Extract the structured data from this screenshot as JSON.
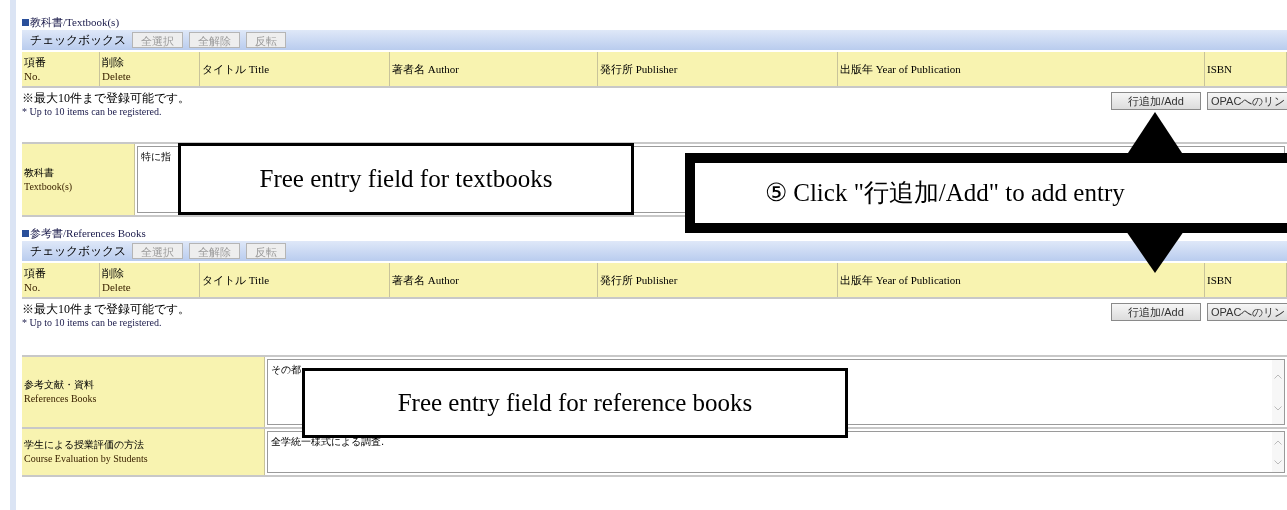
{
  "sections": [
    {
      "title": "教科書/Textbook(s)",
      "toolbar": {
        "label": "チェックボックス",
        "buttons": [
          {
            "label": "全選択",
            "disabled": true
          },
          {
            "label": "全解除",
            "disabled": true
          },
          {
            "label": "反転",
            "disabled": true
          }
        ]
      },
      "columns": [
        {
          "lines": [
            "項番",
            "No."
          ]
        },
        {
          "lines": [
            "削除",
            "Delete"
          ]
        },
        {
          "lines": [
            "タイトル Title"
          ]
        },
        {
          "lines": [
            "著者名 Author"
          ]
        },
        {
          "lines": [
            "発行所 Publisher"
          ]
        },
        {
          "lines": [
            "出版年 Year of Publication"
          ]
        },
        {
          "lines": [
            "ISBN"
          ]
        }
      ],
      "notes": [
        "※最大10件まで登録可能です。",
        "* Up to 10 items can be registered."
      ],
      "buttons": [
        "行追加/Add",
        "OPACへのリン"
      ],
      "fields": [
        {
          "label_ja": "教科書",
          "label_en": "Textbook(s)",
          "value": "特に指"
        }
      ]
    },
    {
      "title": "参考書/References Books",
      "toolbar": {
        "label": "チェックボックス",
        "buttons": [
          {
            "label": "全選択",
            "disabled": true
          },
          {
            "label": "全解除",
            "disabled": true
          },
          {
            "label": "反転",
            "disabled": true
          }
        ]
      },
      "columns": [
        {
          "lines": [
            "項番",
            "No."
          ]
        },
        {
          "lines": [
            "削除",
            "Delete"
          ]
        },
        {
          "lines": [
            "タイトル Title"
          ]
        },
        {
          "lines": [
            "著者名 Author"
          ]
        },
        {
          "lines": [
            "発行所 Publisher"
          ]
        },
        {
          "lines": [
            "出版年 Year of Publication"
          ]
        },
        {
          "lines": [
            "ISBN"
          ]
        }
      ],
      "notes": [
        "※最大10件まで登録可能です。",
        "* Up to 10 items can be registered."
      ],
      "buttons": [
        "行追加/Add",
        "OPACへのリン"
      ],
      "fields": [
        {
          "label_ja": "参考文献・資料",
          "label_en": "References Books",
          "value": "その都",
          "scrollbar": true
        },
        {
          "label_ja": "学生による授業評価の方法",
          "label_en": "Course Evaluation by Students",
          "value": "全学統一様式による調査.",
          "scrollbar": true
        }
      ]
    }
  ],
  "annotations": [
    {
      "kind": "box",
      "text": "Free entry field for textbooks"
    },
    {
      "kind": "arrow-callout",
      "text": "⑤ Click \"行追加/Add\" to add entry"
    },
    {
      "kind": "box",
      "text": "Free entry field for reference books"
    }
  ]
}
